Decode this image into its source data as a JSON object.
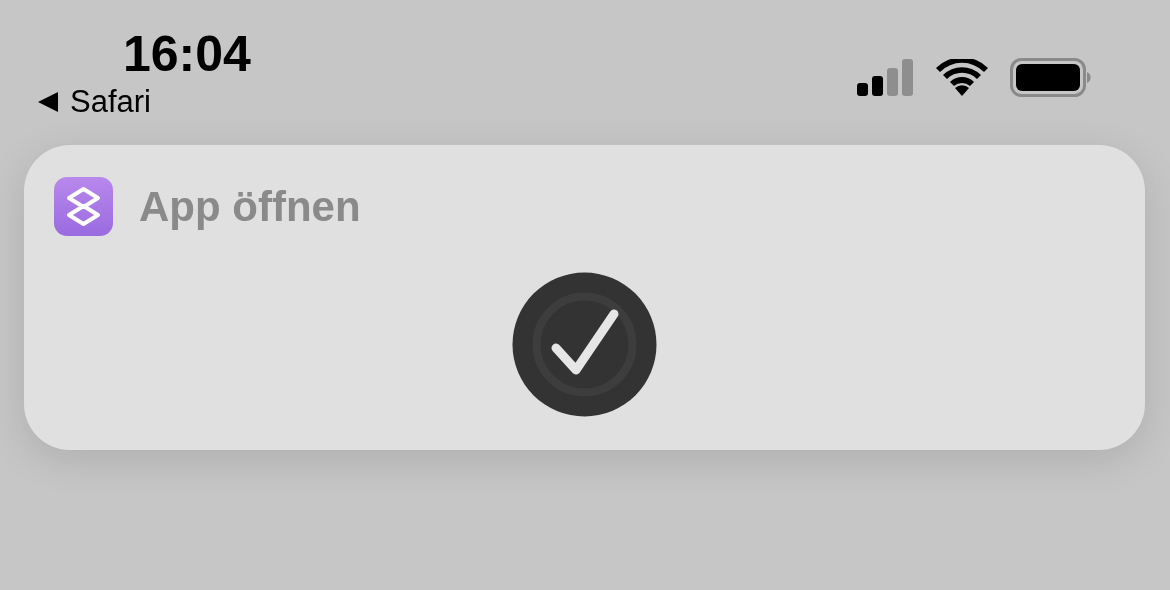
{
  "status_bar": {
    "time": "16:04",
    "back_app": "Safari"
  },
  "notification": {
    "title": "App öffnen",
    "done": true
  }
}
